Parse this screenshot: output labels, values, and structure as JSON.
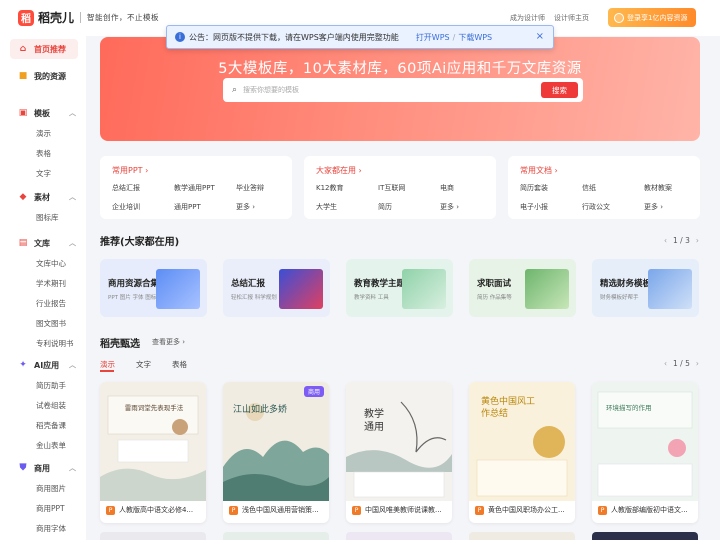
{
  "brand": {
    "logo_char": "稻",
    "name": "稻壳儿",
    "slogan": "智能创作，不止模板"
  },
  "header": {
    "become_designer": "成为设计师",
    "designer_home": "设计师主页",
    "cta": "登录享1亿内容资源"
  },
  "notice": {
    "text": "公告：网页版不提供下载，请在WPS客户端内使用完整功能",
    "open_wps": "打开WPS",
    "slash": "/",
    "download_wps": "下载WPS",
    "close": "×"
  },
  "sidebar": {
    "home": "首页推荐",
    "my_resources": "我的资源",
    "groups": [
      {
        "label": "模板",
        "items": [
          "演示",
          "表格",
          "文字"
        ]
      },
      {
        "label": "素材",
        "items": [
          "图标库"
        ]
      },
      {
        "label": "文库",
        "items": [
          "文库中心",
          "学术期刊",
          "行业报告",
          "图文图书",
          "专利说明书"
        ]
      },
      {
        "label": "AI应用",
        "items": [
          "简历助手",
          "试卷组装",
          "稻壳备课",
          "金山表单"
        ]
      },
      {
        "label": "商用",
        "items": [
          "商用图片",
          "商用PPT",
          "商用字体"
        ]
      }
    ]
  },
  "hero": {
    "title": "5大模板库，10大素材库，60项Ai应用和千万文库资源",
    "search_placeholder": "搜索你想要的模板",
    "search_button": "搜索"
  },
  "categories": [
    {
      "title": "常用PPT",
      "items": [
        "总结汇报",
        "教学通用PPT",
        "毕业答辩",
        "企业培训",
        "通用PPT",
        "更多"
      ]
    },
    {
      "title": "大家都在用",
      "items": [
        "K12教育",
        "IT互联网",
        "电商",
        "大学生",
        "简历",
        "更多"
      ]
    },
    {
      "title": "常用文档",
      "items": [
        "简历套装",
        "信纸",
        "教材教案",
        "电子小报",
        "行政公文",
        "更多"
      ]
    }
  ],
  "recommend": {
    "title": "推荐(大家都在用)",
    "pager": "1 / 3",
    "cards": [
      {
        "title": "商用资源合集",
        "sub": "PPT 图片 字体 图标",
        "bg": "#e6ecfb"
      },
      {
        "title": "总结汇报",
        "sub": "轻松汇报 科学规划",
        "bg": "#eaeefa"
      },
      {
        "title": "教育教学主题",
        "sub": "教学资料 工具",
        "bg": "#e4f4ec"
      },
      {
        "title": "求职面试",
        "sub": "简历 作品集等",
        "bg": "#e6f3e6"
      },
      {
        "title": "精选财务模板",
        "sub": "财务模板好帮手",
        "bg": "#e5eef9"
      }
    ]
  },
  "selection": {
    "title": "稻壳甄选",
    "more": "查看更多",
    "tabs": [
      "演示",
      "文字",
      "表格"
    ],
    "pager": "1 / 5",
    "cards": [
      {
        "caption": "人教版高中语文必修4...",
        "title_art": "雷雨词堂先表现手法",
        "bg": "#f3efe6",
        "badge": ""
      },
      {
        "caption": "浅色中国风通用营销策...",
        "title_art": "江山如此多娇",
        "bg": "#f1ece2",
        "badge": "商用"
      },
      {
        "caption": "中国风唯美教师说课教...",
        "title_art": "教学通用",
        "bg": "#f4f2ee",
        "badge": ""
      },
      {
        "caption": "黄色中国风职场办公工...",
        "title_art": "黄色中国风工作总结",
        "bg": "#faf1dc",
        "badge": ""
      },
      {
        "caption": "人教版部编版初中语文...",
        "title_art": "环境描写的作用",
        "bg": "#eef4ef",
        "badge": ""
      }
    ]
  },
  "colors": {
    "accent": "#e8453c",
    "link": "#3b6fd8",
    "cta": "#ff9a30"
  }
}
